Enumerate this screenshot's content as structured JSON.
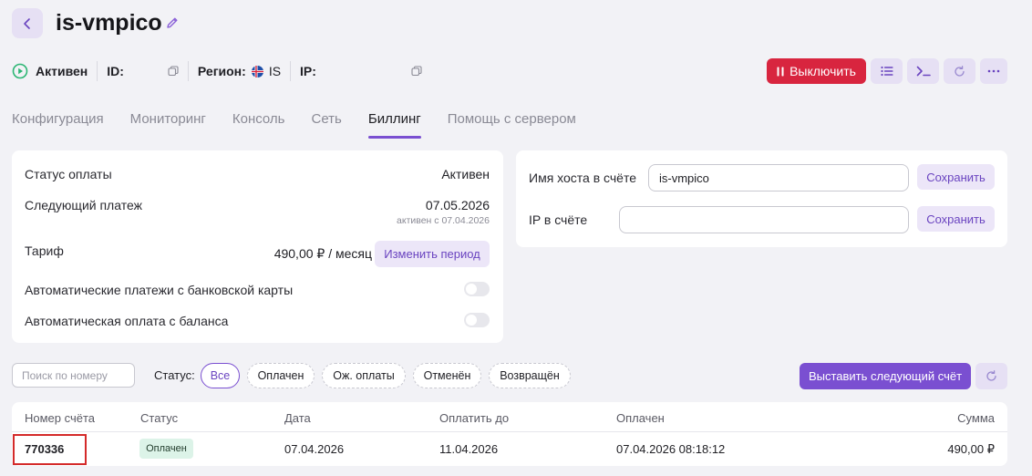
{
  "header": {
    "title": "is-vmpico"
  },
  "status": {
    "state": "Активен",
    "id_label": "ID:",
    "region_label": "Регион:",
    "region_code": "IS",
    "ip_label": "IP:"
  },
  "actions": {
    "shutdown_label": "Выключить"
  },
  "tabs": [
    {
      "label": "Конфигурация"
    },
    {
      "label": "Мониторинг"
    },
    {
      "label": "Консоль"
    },
    {
      "label": "Сеть"
    },
    {
      "label": "Биллинг"
    },
    {
      "label": "Помощь с сервером"
    }
  ],
  "billing": {
    "pay_status_label": "Статус оплаты",
    "pay_status_value": "Активен",
    "next_payment_label": "Следующий платеж",
    "next_payment_value": "07.05.2026",
    "next_payment_note": "активен с 07.04.2026",
    "tariff_label": "Тариф",
    "tariff_value": "490,00 ₽ / месяц",
    "change_period_label": "Изменить период",
    "auto_card_label": "Автоматические платежи с банковской карты",
    "auto_balance_label": "Автоматическая оплата с баланса"
  },
  "invoice_settings": {
    "hostname_label": "Имя хоста в счёте",
    "hostname_value": "is-vmpico",
    "ip_label": "IP в счёте",
    "ip_value": "",
    "save_label": "Сохранить"
  },
  "filters": {
    "search_placeholder": "Поиск по номеру",
    "status_label": "Статус:",
    "chips": [
      "Все",
      "Оплачен",
      "Ож. оплаты",
      "Отменён",
      "Возвращён"
    ],
    "issue_next_label": "Выставить следующий счёт"
  },
  "table": {
    "columns": [
      "Номер счёта",
      "Статус",
      "Дата",
      "Оплатить до",
      "Оплачен",
      "Сумма"
    ],
    "rows": [
      {
        "number": "770336",
        "status": "Оплачен",
        "date": "07.04.2026",
        "pay_until": "11.04.2026",
        "paid_at": "07.04.2026 08:18:12",
        "amount": "490,00 ₽"
      }
    ]
  },
  "colors": {
    "accent": "#7a4fd1",
    "danger": "#d8253f",
    "success_badge": "#dcf3e8"
  }
}
